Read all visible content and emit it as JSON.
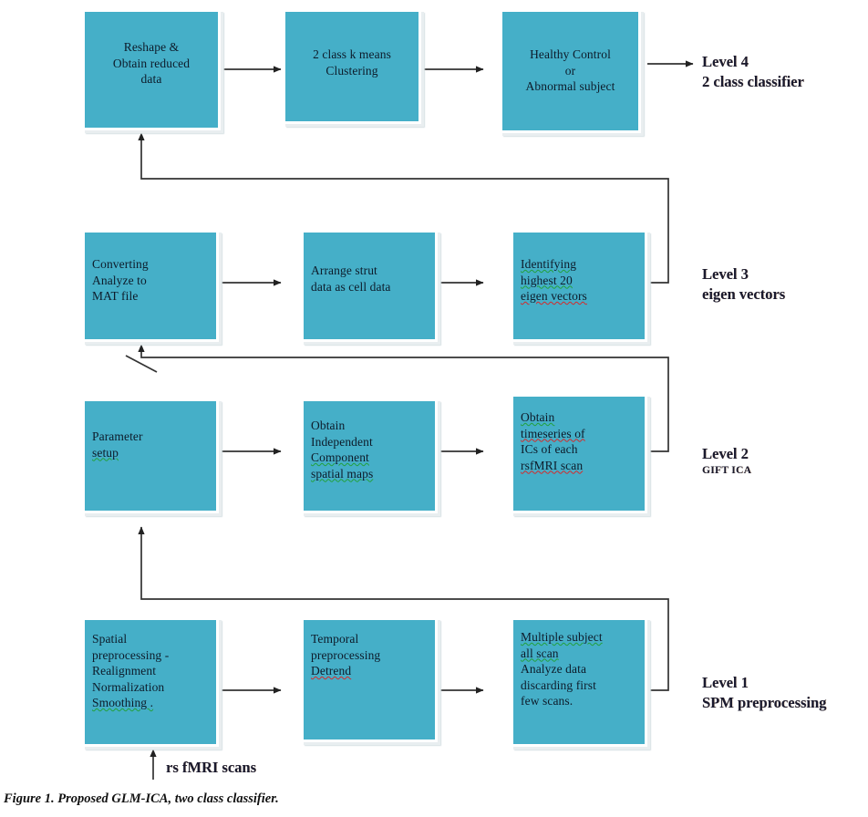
{
  "figure": {
    "caption": "Figure 1. Proposed GLM-ICA, two class classifier.",
    "input_label": "rs fMRI scans",
    "box_fill_color": "#45AFC8",
    "box_border_color": "#FFFFFF",
    "connector_color": "#333333",
    "background_color": "#FFFFFF"
  },
  "levels": [
    {
      "id": "level-4",
      "title": "Level 4",
      "subtitle": "2 class classifier",
      "subtitle_small": false,
      "nodes": [
        {
          "id": "reshape-obtain-reduced-data",
          "align": "center",
          "lines": [
            "Reshape &",
            "Obtain reduced",
            "data"
          ]
        },
        {
          "id": "two-class-k-means-clustering",
          "align": "center",
          "lines": [
            "2 class k means",
            "Clustering"
          ]
        },
        {
          "id": "healthy-control-or-abnormal-subject",
          "align": "center",
          "lines": [
            "Healthy Control",
            "or",
            "Abnormal subject"
          ]
        }
      ]
    },
    {
      "id": "level-3",
      "title": "Level 3",
      "subtitle": "eigen vectors",
      "subtitle_small": false,
      "nodes": [
        {
          "id": "converting-analyze-to-mat-file",
          "align": "left",
          "lines": [
            "Converting",
            "Analyze to",
            "MAT file"
          ]
        },
        {
          "id": "arrange-strut-data-as-cell-data",
          "align": "left",
          "lines": [
            "Arrange strut",
            "data as cell data"
          ]
        },
        {
          "id": "identifying-highest-20-eigen-vectors",
          "align": "left",
          "lines": [
            "Identifying",
            "highest  20",
            "eigen vectors"
          ]
        }
      ]
    },
    {
      "id": "level-2",
      "title": "Level 2",
      "subtitle": "GIFT ICA",
      "subtitle_small": true,
      "nodes": [
        {
          "id": "parameter-setup",
          "align": "left",
          "lines": [
            "Parameter",
            "setup"
          ]
        },
        {
          "id": "obtain-independent-component-spatial-maps",
          "align": "left",
          "lines": [
            "Obtain",
            "Independent",
            "Component",
            "spatial maps"
          ]
        },
        {
          "id": "obtain-timeseries-of-ics-of-each-rsfmri-scan",
          "align": "left",
          "lines": [
            "Obtain",
            "timeseries  of",
            "ICs  of  each",
            "rsfMRI scan"
          ]
        }
      ]
    },
    {
      "id": "level-1",
      "title": "Level 1",
      "subtitle": "SPM preprocessing",
      "subtitle_small": false,
      "nodes": [
        {
          "id": "spatial-preprocessing",
          "align": "left",
          "lines": [
            "Spatial",
            "preprocessing -",
            "Realignment",
            "Normalization",
            "Smoothing ."
          ]
        },
        {
          "id": "temporal-preprocessing-detrend",
          "align": "left",
          "lines": [
            "Temporal",
            "preprocessing",
            "Detrend"
          ]
        },
        {
          "id": "multiple-subject-all-scan-analyze-data",
          "align": "left",
          "lines": [
            "Multiple subject",
            "all scan",
            "Analyze  data",
            "discarding first",
            "few scans."
          ]
        }
      ]
    }
  ]
}
